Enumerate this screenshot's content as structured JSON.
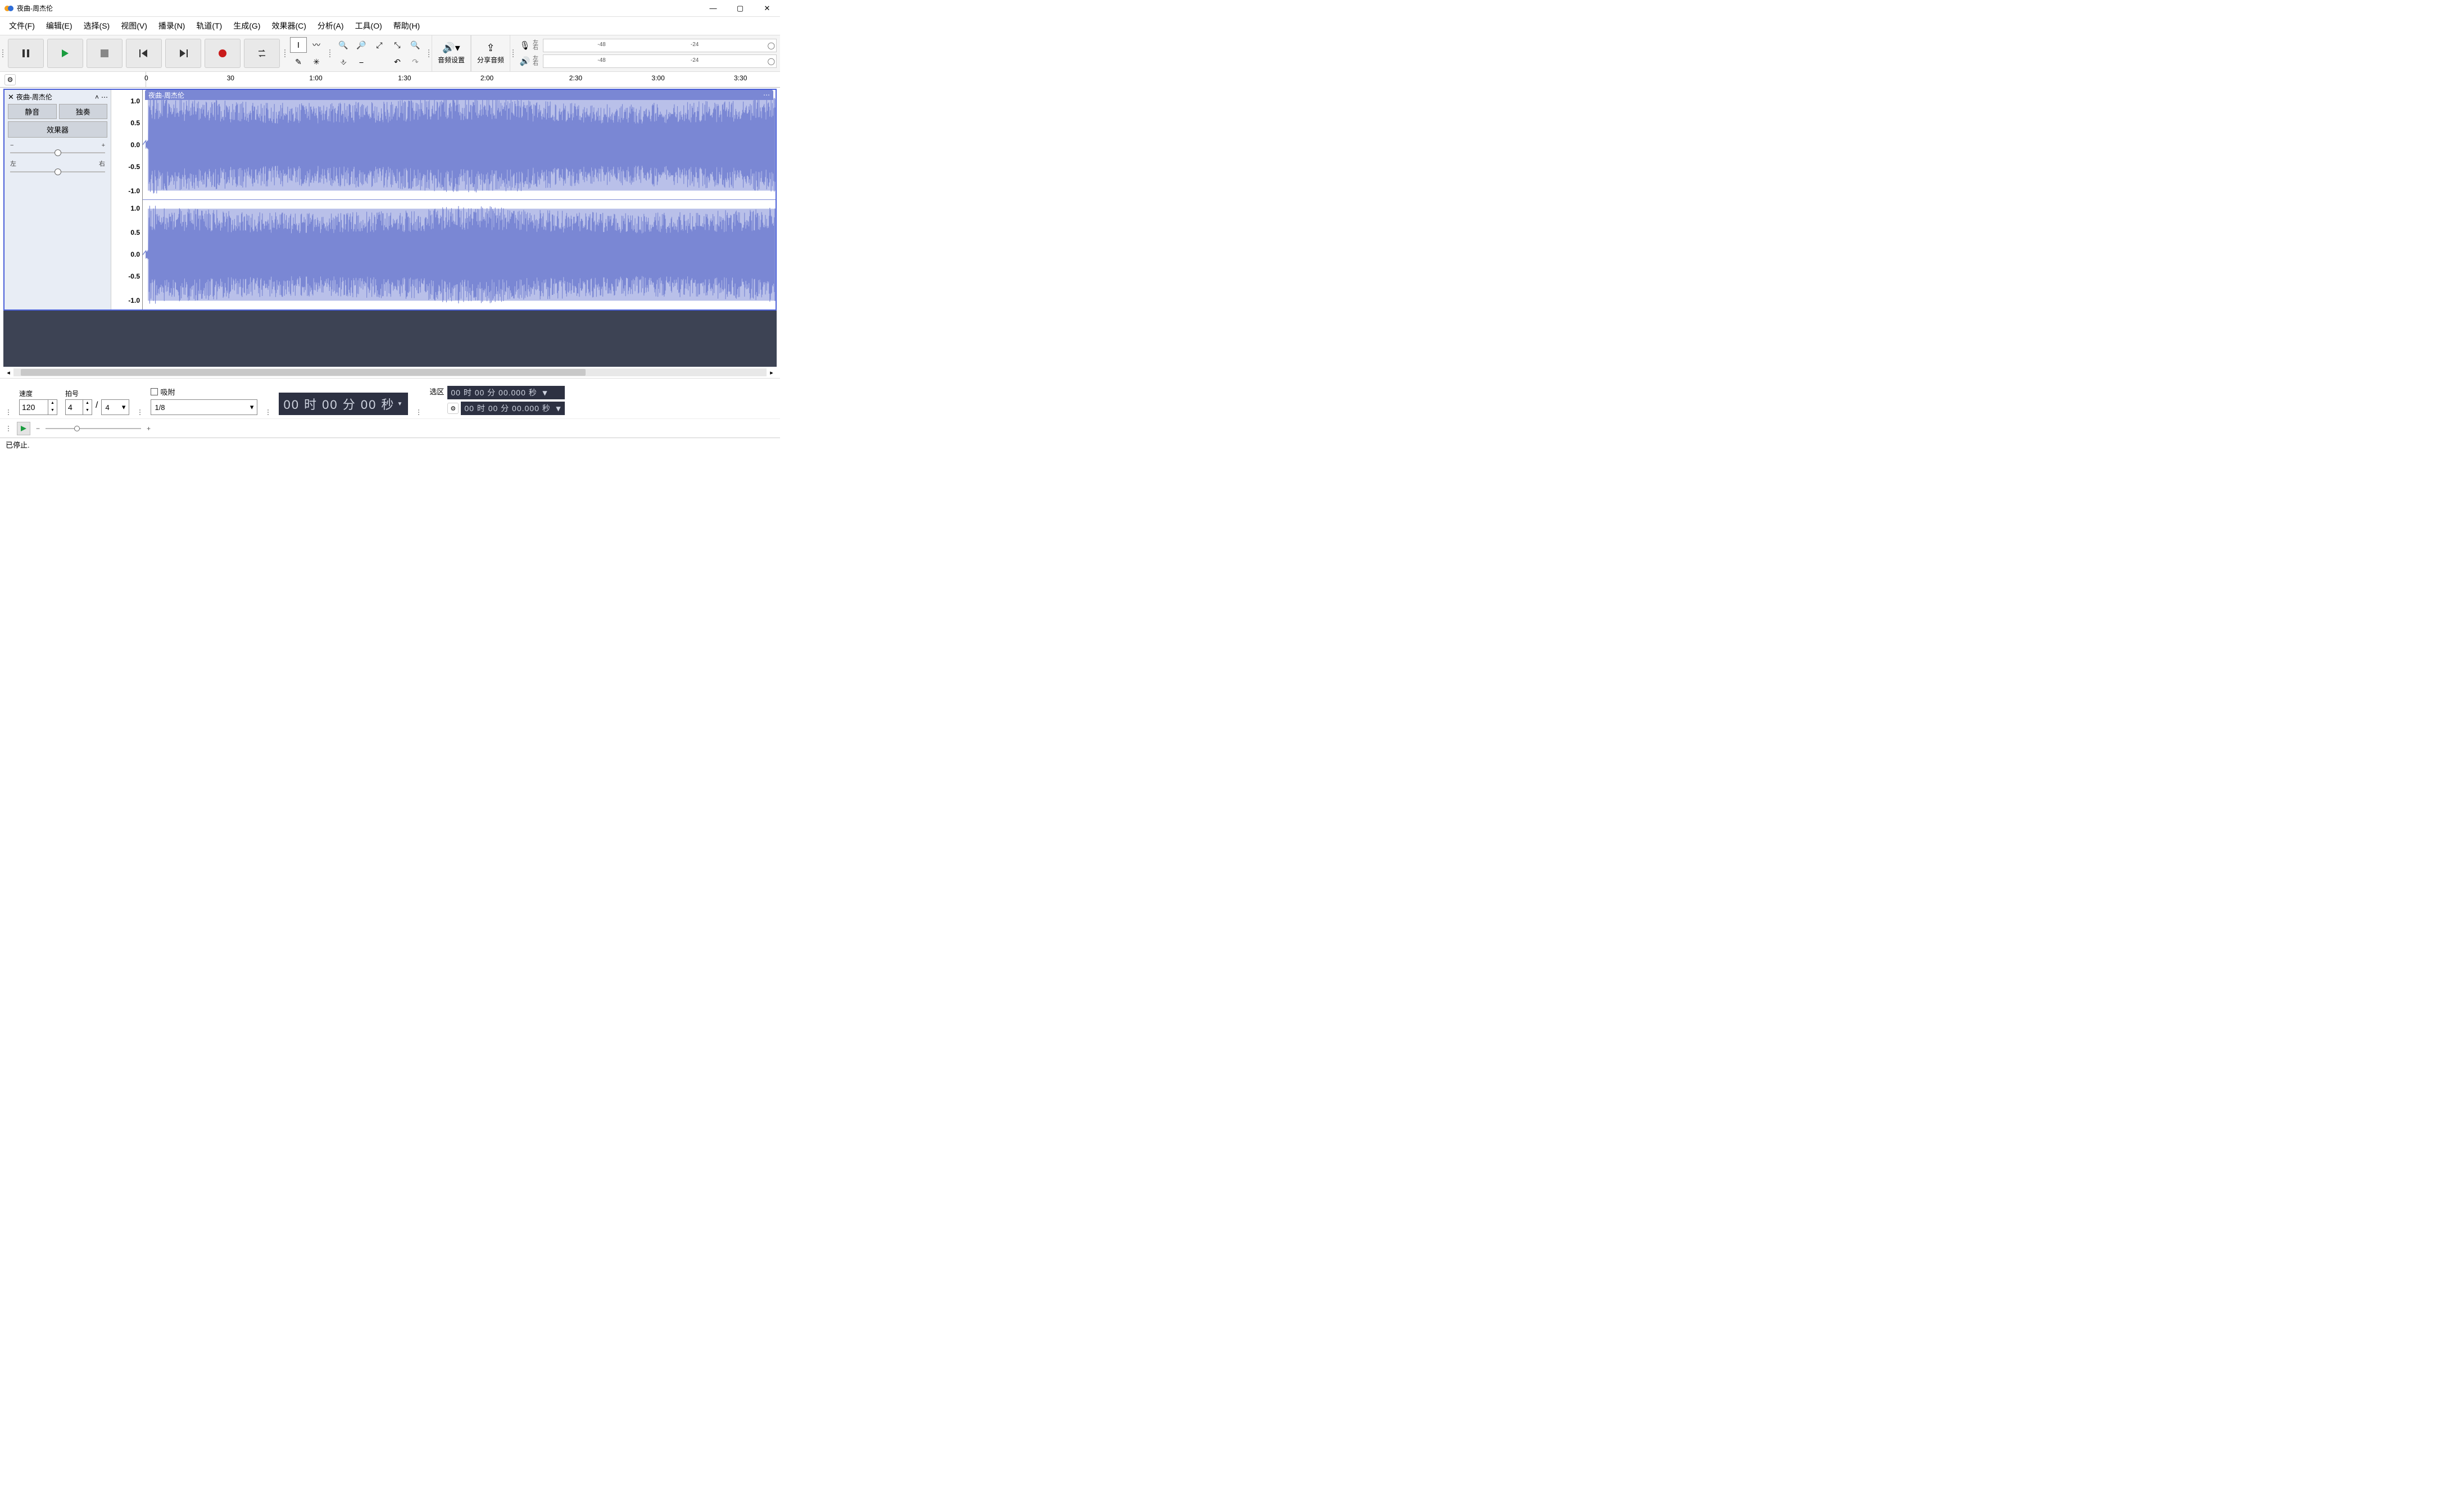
{
  "window": {
    "title": "夜曲-周杰伦"
  },
  "menu": {
    "file": "文件(F)",
    "edit": "编辑(E)",
    "select": "选择(S)",
    "view": "视图(V)",
    "transport": "播录(N)",
    "tracks": "轨道(T)",
    "generate": "生成(G)",
    "effect": "效果器(C)",
    "analyze": "分析(A)",
    "tools": "工具(O)",
    "help": "帮助(H)"
  },
  "toolbar": {
    "audio_setup": "音频设置",
    "share_audio": "分享音频",
    "meter_ticks": {
      "t1": "-48",
      "t2": "-24"
    },
    "meter_lr": {
      "left": "左",
      "right": "右"
    }
  },
  "ruler": {
    "marks": [
      "0",
      "30",
      "1:00",
      "1:30",
      "2:00",
      "2:30",
      "3:00",
      "3:30"
    ]
  },
  "track": {
    "name": "夜曲-周杰伦",
    "mute": "静音",
    "solo": "独奏",
    "effects": "效果器",
    "gain_minus": "−",
    "gain_plus": "+",
    "pan_left": "左",
    "pan_right": "右",
    "scale": [
      "1.0",
      "0.5",
      "0.0",
      "-0.5",
      "-1.0"
    ],
    "clip_menu": "⋯"
  },
  "bottom": {
    "tempo_label": "速度",
    "tempo_value": "120",
    "sig_label": "拍号",
    "sig_upper": "4",
    "sig_lower": "4",
    "snap_label": "吸附",
    "snap_value": "1/8",
    "main_timecode": "00 时 00 分 00 秒",
    "selection_label": "选区",
    "sel_start": "00 时 00 分 00.000 秒",
    "sel_end": "00 时 00 分 00.000 秒"
  },
  "status": {
    "text": "已停止."
  }
}
